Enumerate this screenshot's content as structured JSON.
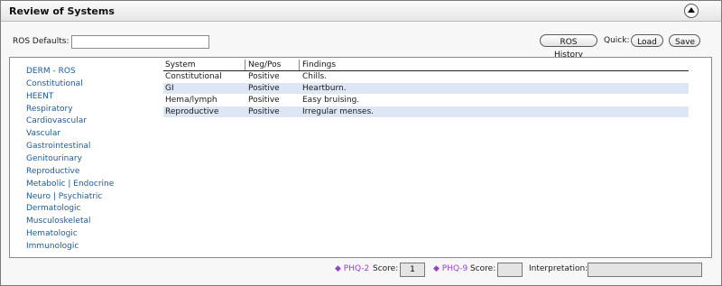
{
  "header": {
    "title": "Review of Systems",
    "collapse_icon": "chevron-up-circle-icon"
  },
  "ros_defaults": {
    "label": "ROS Defaults:",
    "value": ""
  },
  "toolbar": {
    "history_label": "ROS History",
    "quick_label": "Quick:",
    "load_label": "Load",
    "save_label": "Save"
  },
  "systems": [
    "DERM - ROS",
    "Constitutional",
    "HEENT",
    "Respiratory",
    "Cardiovascular",
    "Vascular",
    "Gastrointestinal",
    "Genitourinary",
    "Reproductive",
    "Metabolic | Endocrine",
    "Neuro | Psychiatric",
    "Dermatologic",
    "Musculoskeletal",
    "Hematologic",
    "Immunologic"
  ],
  "table": {
    "headers": {
      "system": "System",
      "negpos": "Neg/Pos",
      "findings": "Findings"
    },
    "rows": [
      {
        "system": "Constitutional",
        "negpos": "Positive",
        "findings": "Chills."
      },
      {
        "system": "GI",
        "negpos": "Positive",
        "findings": "Heartburn."
      },
      {
        "system": "Hema/lymph",
        "negpos": "Positive",
        "findings": "Easy bruising."
      },
      {
        "system": "Reproductive",
        "negpos": "Positive",
        "findings": "Irregular menses."
      }
    ],
    "alt_row_color": "#dde6f4"
  },
  "footer": {
    "phq2": {
      "label": "◆ PHQ-2",
      "score_label": "Score:",
      "score": "1"
    },
    "phq9": {
      "label": "◆ PHQ-9",
      "score_label": "Score:",
      "score": ""
    },
    "interpretation": {
      "label": "Interpretation:",
      "value": ""
    },
    "phq_color": "#9a3fd0"
  }
}
